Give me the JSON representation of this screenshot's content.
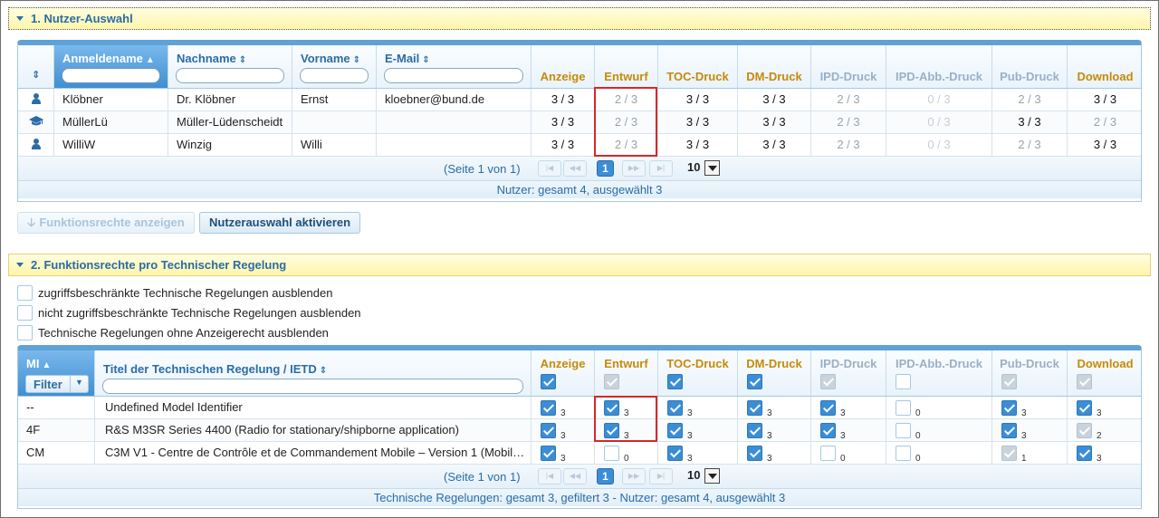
{
  "panel1": {
    "title": "1. Nutzer-Auswahl"
  },
  "users_grid": {
    "columns": {
      "login": "Anmeldename",
      "lastname": "Nachname",
      "firstname": "Vorname",
      "email": "E-Mail",
      "anzeige": "Anzeige",
      "entwurf": "Entwurf",
      "toc": "TOC-Druck",
      "dm": "DM-Druck",
      "ipd": "IPD-Druck",
      "ipdabb": "IPD-Abb.-Druck",
      "pub": "Pub-Druck",
      "download": "Download"
    },
    "rows": [
      {
        "icon": "person-icon",
        "login": "Klöbner",
        "lastname": "Dr. Klöbner",
        "firstname": "Ernst",
        "email": "kloebner@bund.de",
        "anzeige": "3 / 3",
        "entwurf": "2 / 3",
        "toc": "3 / 3",
        "dm": "3 / 3",
        "ipd": "2 / 3",
        "ipdabb": "0 / 3",
        "pub": "2 / 3",
        "download": "3 / 3"
      },
      {
        "icon": "graduation-cap-icon",
        "login": "MüllerLü",
        "lastname": "Müller-Lüdenscheidt",
        "firstname": "",
        "email": "",
        "anzeige": "3 / 3",
        "entwurf": "2 / 3",
        "toc": "3 / 3",
        "dm": "3 / 3",
        "ipd": "2 / 3",
        "ipdabb": "0 / 3",
        "pub": "3 / 3",
        "download": "2 / 3"
      },
      {
        "icon": "person-icon",
        "login": "WilliW",
        "lastname": "Winzig",
        "firstname": "Willi",
        "email": "",
        "anzeige": "3 / 3",
        "entwurf": "2 / 3",
        "toc": "3 / 3",
        "dm": "3 / 3",
        "ipd": "2 / 3",
        "ipdabb": "0 / 3",
        "pub": "2 / 3",
        "download": "3 / 3"
      }
    ],
    "pager": {
      "text": "(Seite 1 von 1)",
      "page": "1",
      "page_size": "10"
    },
    "footer": "Nutzer: gesamt 4, ausgewählt 3"
  },
  "buttons": {
    "show_rights": "Funktionsrechte anzeigen",
    "activate": "Nutzerauswahl aktivieren"
  },
  "panel2": {
    "title": "2. Funktionsrechte pro Technischer Regelung"
  },
  "options": [
    "zugriffsbeschränkte Technische Regelungen ausblenden",
    "nicht zugriffsbeschränkte Technische Regelungen ausblenden",
    "Technische Regelungen ohne Anzeigerecht ausblenden"
  ],
  "rules_grid": {
    "columns": {
      "mi": "MI",
      "filter": "Filter",
      "title": "Titel der Technischen Regelung / IETD"
    },
    "rows": [
      {
        "mi": "--",
        "title": "Undefined Model Identifier",
        "counts": [
          "3",
          "3",
          "3",
          "3",
          "3",
          "0",
          "3",
          "3"
        ],
        "states": [
          "on",
          "on",
          "on",
          "on",
          "on",
          "off",
          "on",
          "on"
        ]
      },
      {
        "mi": "4F",
        "title": "R&S M3SR Series 4400 (Radio for stationary/shipborne application)",
        "counts": [
          "3",
          "3",
          "3",
          "3",
          "3",
          "0",
          "3",
          "2"
        ],
        "states": [
          "on",
          "on",
          "on",
          "on",
          "on",
          "off",
          "on",
          "gon"
        ]
      },
      {
        "mi": "CM",
        "title": "C3M V1 - Centre de Contrôle et de Commandement Mobile – Version 1 (Mobil…",
        "counts": [
          "3",
          "0",
          "3",
          "3",
          "0",
          "0",
          "1",
          "3"
        ],
        "states": [
          "on",
          "off",
          "on",
          "on",
          "off",
          "off",
          "gon",
          "on"
        ]
      }
    ],
    "pager": {
      "text": "(Seite 1 von 1)",
      "page": "1",
      "page_size": "10"
    },
    "footer": "Technische Regelungen: gesamt 3, gefiltert 3 - Nutzer: gesamt 4, ausgewählt 3"
  }
}
